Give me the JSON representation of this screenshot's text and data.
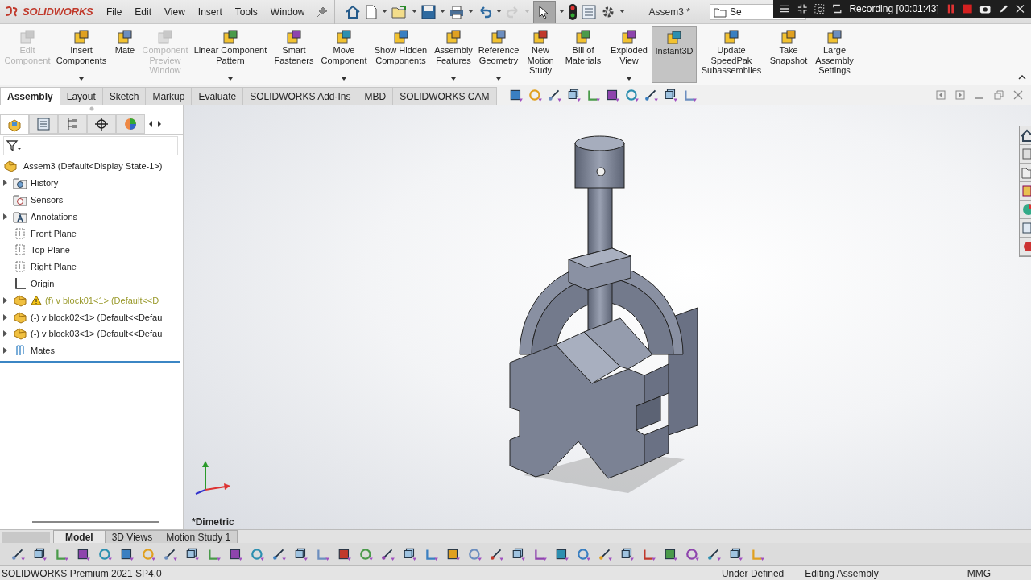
{
  "app": {
    "logo": "SOLIDWORKS",
    "menus": [
      "File",
      "Edit",
      "View",
      "Insert",
      "Tools",
      "Window"
    ],
    "document_title": "Assem3 *",
    "search": {
      "value": "Se"
    }
  },
  "recorder": {
    "status": "Recording [00:01:43]"
  },
  "ribbon": [
    {
      "label": "Edit Component",
      "disabled": true,
      "selected": false,
      "has_menu": false
    },
    {
      "label": "Insert Components",
      "disabled": false,
      "selected": false,
      "has_menu": true
    },
    {
      "label": "Mate",
      "disabled": false,
      "selected": false,
      "has_menu": false
    },
    {
      "label": "Component Preview Window",
      "disabled": true,
      "selected": false,
      "has_menu": false
    },
    {
      "label": "Linear Component Pattern",
      "disabled": false,
      "selected": false,
      "has_menu": true
    },
    {
      "label": "Smart Fasteners",
      "disabled": false,
      "selected": false,
      "has_menu": false
    },
    {
      "label": "Move Component",
      "disabled": false,
      "selected": false,
      "has_menu": true
    },
    {
      "label": "Show Hidden Components",
      "disabled": false,
      "selected": false,
      "has_menu": false
    },
    {
      "label": "Assembly Features",
      "disabled": false,
      "selected": false,
      "has_menu": true
    },
    {
      "label": "Reference Geometry",
      "disabled": false,
      "selected": false,
      "has_menu": true
    },
    {
      "label": "New Motion Study",
      "disabled": false,
      "selected": false,
      "has_menu": false
    },
    {
      "label": "Bill of Materials",
      "disabled": false,
      "selected": false,
      "has_menu": false
    },
    {
      "label": "Exploded View",
      "disabled": false,
      "selected": false,
      "has_menu": true
    },
    {
      "label": "Instant3D",
      "disabled": false,
      "selected": true,
      "has_menu": false
    },
    {
      "label": "Update SpeedPak Subassemblies",
      "disabled": false,
      "selected": false,
      "has_menu": false
    },
    {
      "label": "Take Snapshot",
      "disabled": false,
      "selected": false,
      "has_menu": false
    },
    {
      "label": "Large Assembly Settings",
      "disabled": false,
      "selected": false,
      "has_menu": false
    }
  ],
  "command_tabs": [
    {
      "label": "Assembly",
      "selected": true
    },
    {
      "label": "Layout",
      "selected": false
    },
    {
      "label": "Sketch",
      "selected": false
    },
    {
      "label": "Markup",
      "selected": false
    },
    {
      "label": "Evaluate",
      "selected": false
    },
    {
      "label": "SOLIDWORKS Add-Ins",
      "selected": false
    },
    {
      "label": "MBD",
      "selected": false
    },
    {
      "label": "SOLIDWORKS CAM",
      "selected": false
    }
  ],
  "tree": {
    "root": "Assem3  (Default<Display State-1>)",
    "items": [
      {
        "kind": "history",
        "label": "History",
        "expandable": true,
        "warning": false
      },
      {
        "kind": "sensor",
        "label": "Sensors",
        "expandable": false,
        "warning": false
      },
      {
        "kind": "annotation",
        "label": "Annotations",
        "expandable": true,
        "warning": false
      },
      {
        "kind": "plane",
        "label": "Front Plane",
        "expandable": false,
        "warning": false
      },
      {
        "kind": "plane",
        "label": "Top Plane",
        "expandable": false,
        "warning": false
      },
      {
        "kind": "plane",
        "label": "Right Plane",
        "expandable": false,
        "warning": false
      },
      {
        "kind": "origin",
        "label": "Origin",
        "expandable": false,
        "warning": false
      },
      {
        "kind": "part",
        "label": "(f) v block01<1> (Default<<D",
        "expandable": true,
        "warning": true
      },
      {
        "kind": "part",
        "label": "(-) v block02<1> (Default<<Defau",
        "expandable": true,
        "warning": false
      },
      {
        "kind": "part",
        "label": "(-) v block03<1> (Default<<Defau",
        "expandable": true,
        "warning": false
      },
      {
        "kind": "mates",
        "label": "Mates",
        "expandable": true,
        "warning": false
      }
    ]
  },
  "viewport": {
    "view_name": "*Dimetric"
  },
  "bottom_tabs": [
    {
      "label": "Model",
      "selected": true
    },
    {
      "label": "3D Views",
      "selected": false
    },
    {
      "label": "Motion Study 1",
      "selected": false
    }
  ],
  "status_bar": {
    "product": "SOLIDWORKS Premium 2021 SP4.0",
    "state": "Under Defined",
    "mode": "Editing Assembly",
    "units": "MMG"
  }
}
